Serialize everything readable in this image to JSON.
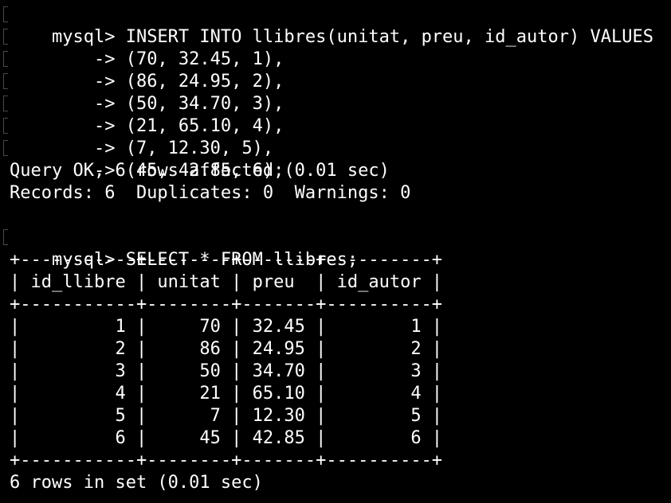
{
  "terminal": {
    "insert": {
      "command": "mysql> INSERT INTO llibres(unitat, preu, id_autor) VALUES",
      "continuations": [
        "    -> (70, 32.45, 1),",
        "    -> (86, 24.95, 2),",
        "    -> (50, 34.70, 3),",
        "    -> (21, 65.10, 4),",
        "    -> (7, 12.30, 5),",
        "    -> (45, 42.85, 6);"
      ],
      "result": "Query OK, 6 rows affected (0.01 sec)",
      "records": "Records: 6  Duplicates: 0  Warnings: 0"
    },
    "select": {
      "command": "mysql> SELECT * FROM llibres;",
      "border": "+-----------+--------+-------+----------+",
      "header": "| id_llibre | unitat | preu  | id_autor |",
      "rows": [
        "|         1 |     70 | 32.45 |        1 |",
        "|         2 |     86 | 24.95 |        2 |",
        "|         3 |     50 | 34.70 |        3 |",
        "|         4 |     21 | 65.10 |        4 |",
        "|         5 |      7 | 12.30 |        5 |",
        "|         6 |     45 | 42.85 |        6 |"
      ],
      "footer": "6 rows in set (0.01 sec)"
    },
    "colors": {
      "background": "#000000",
      "text": "#ffffff",
      "marker": "#4a4a4a"
    }
  }
}
